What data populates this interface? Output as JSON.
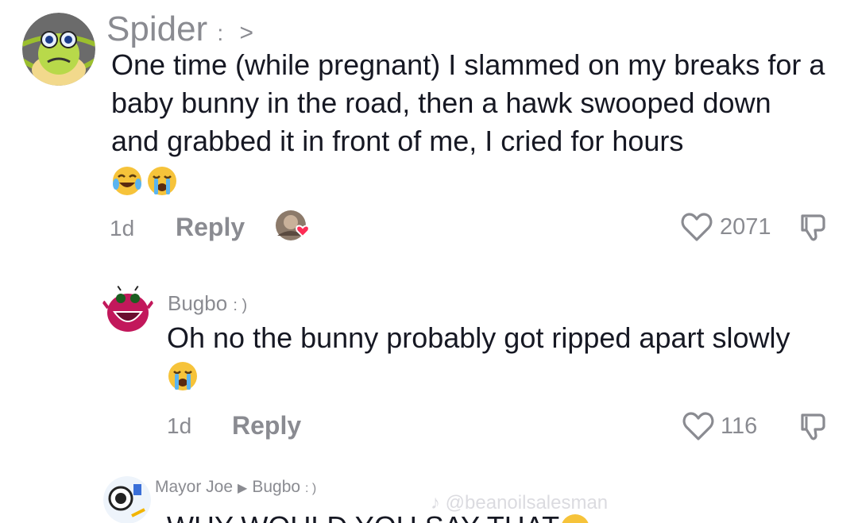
{
  "comments": [
    {
      "username": "Spider",
      "username_suffix": ":",
      "chevron": ">",
      "text": "One time (while pregnant) I slammed on my breaks for a baby bunny in the road, then a hawk swooped down and grabbed it in front of me, I cried for hours",
      "emojis": [
        "joy-emoji",
        "loudly-crying-emoji"
      ],
      "time": "1d",
      "reply_label": "Reply",
      "likes": "2071",
      "liked_by_creator": true
    },
    {
      "username": "Bugbo",
      "username_suffix": ": )",
      "text": "Oh no the bunny probably got ripped apart slowly",
      "emojis": [
        "loudly-crying-emoji"
      ],
      "time": "1d",
      "reply_label": "Reply",
      "likes": "116"
    },
    {
      "username": "Mayor Joe",
      "reply_to": "Bugbo",
      "reply_to_suffix": ": )",
      "text": "WHY WOULD YOU SAY THAT",
      "emojis": [
        "loudly-crying-emoji"
      ]
    }
  ],
  "watermark": "@beanoilsalesman",
  "colors": {
    "muted_text": "#8a8b91",
    "body_text": "#161823",
    "liked_heart": "#fe2c55"
  }
}
